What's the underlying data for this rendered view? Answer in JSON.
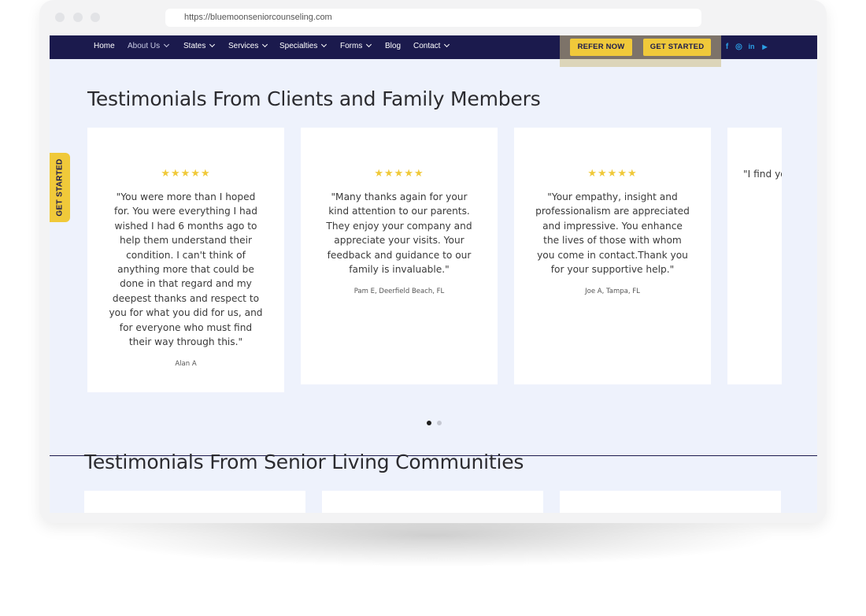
{
  "browser": {
    "url": "https://bluemoonseniorcounseling.com"
  },
  "nav": {
    "items": [
      {
        "label": "Home",
        "dropdown": false
      },
      {
        "label": "About Us",
        "dropdown": true,
        "active": true
      },
      {
        "label": "States",
        "dropdown": true
      },
      {
        "label": "Services",
        "dropdown": true
      },
      {
        "label": "Specialties",
        "dropdown": true
      },
      {
        "label": "Forms",
        "dropdown": true
      },
      {
        "label": "Blog",
        "dropdown": false
      },
      {
        "label": "Contact",
        "dropdown": true
      }
    ],
    "refer_label": "REFER NOW",
    "started_label": "GET STARTED",
    "social_icons": [
      "facebook-icon",
      "instagram-icon",
      "linkedin-icon",
      "youtube-icon"
    ],
    "social_glyphs": [
      "f",
      "◎",
      "in",
      "▶"
    ]
  },
  "side_tab": {
    "label": "GET STARTED"
  },
  "section1": {
    "title": "Testimonials From Clients and Family Members",
    "cards": [
      {
        "stars": "★★★★★",
        "rating": 5,
        "quote": "\"You were more than I hoped for. You were everything I had wished I had 6 months ago to help them understand their condition. I can't think of anything more that could be done in that regard and my deepest thanks and respect to you for what you did for us, and for everyone who must find their way through this.\"",
        "author": "Alan A"
      },
      {
        "stars": "★★★★★",
        "rating": 5,
        "quote": "\"Many thanks again for your kind attention to our parents. They enjoy your company and appreciate your visits. Your feedback and guidance to our family is invaluable.\"",
        "author": "Pam E, Deerfield Beach, FL"
      },
      {
        "stars": "★★★★★",
        "rating": 5,
        "quote": "\"Your empathy, insight and professionalism are appreciated and impressive. You enhance the lives of those with whom you come in contact.Thank you for your supportive help.\"",
        "author": "Joe A, Tampa, FL"
      },
      {
        "stars": "",
        "quote": "\"I find you. I'm",
        "author": ""
      }
    ],
    "pager": {
      "count": 2,
      "active": 0
    }
  },
  "section2": {
    "title": "Testimonials From Senior Living Communities"
  },
  "colors": {
    "nav_bg": "#1b1a4d",
    "accent_yellow": "#f0c93a",
    "page_bg": "#eef2fc",
    "social_blue": "#2b9fe6"
  }
}
